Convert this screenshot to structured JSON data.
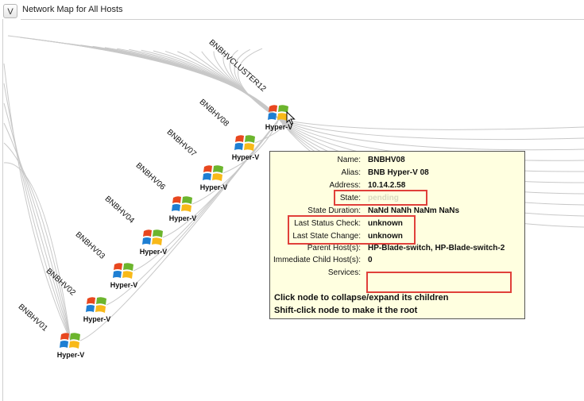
{
  "header": {
    "toggle_label": "V",
    "title": "Network Map for All Hosts"
  },
  "cluster": {
    "label": "BNBHVCLUSTER12"
  },
  "hosts": [
    {
      "name": "BNBHV08",
      "icon_label": "Hyper-V"
    },
    {
      "name": "BNBHV07",
      "icon_label": "Hyper-V"
    },
    {
      "name": "BNBHV06",
      "icon_label": "Hyper-V"
    },
    {
      "name": "BNBHV04",
      "icon_label": "Hyper-V"
    },
    {
      "name": "BNBHV03",
      "icon_label": "Hyper-V"
    },
    {
      "name": "BNBHV02",
      "icon_label": "Hyper-V"
    },
    {
      "name": "BNBHV01",
      "icon_label": "Hyper-V"
    }
  ],
  "extra_node": {
    "icon_label": "Hyper-V"
  },
  "tooltip": {
    "rows": [
      {
        "key": "Name:",
        "value": "BNBHV08"
      },
      {
        "key": "Alias:",
        "value": "BNB Hyper-V 08"
      },
      {
        "key": "Address:",
        "value": "10.14.2.58"
      },
      {
        "key": "State:",
        "value": "pending"
      },
      {
        "key": "State Duration:",
        "value": "NaNd NaNh NaNm NaNs"
      },
      {
        "key": "Last Status Check:",
        "value": "unknown"
      },
      {
        "key": "Last State Change:",
        "value": "unknown"
      },
      {
        "key": "Parent Host(s):",
        "value": "HP-Blade-switch, HP-Blade-switch-2"
      },
      {
        "key": "Immediate Child Host(s):",
        "value": "0"
      },
      {
        "key": "Services:",
        "value": ""
      }
    ],
    "hint_collapse": "Click node to collapse/expand its children",
    "hint_root": "Shift-click node to make it the root"
  },
  "colors": {
    "tooltip_bg": "#ffffe0",
    "highlight_box": "#e0403a",
    "edge": "#c8c8c8"
  },
  "icons": {
    "node": "windows-logo-icon",
    "cursor": "mouse-pointer-icon"
  }
}
